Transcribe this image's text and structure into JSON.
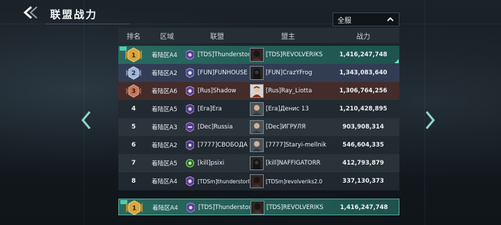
{
  "header": {
    "title": "联盟战力",
    "region_selected": "全服"
  },
  "columns": {
    "rank": "排名",
    "zone": "区域",
    "alliance": "联盟",
    "leader": "盟主",
    "power": "战力"
  },
  "rows": [
    {
      "rank": "1",
      "zone": "着陆区A4",
      "alliance": "[TDS]Thunderstorm",
      "leader": "[TDS]REVOLVERIKS",
      "power": "1,416,247,748"
    },
    {
      "rank": "2",
      "zone": "着陆区A2",
      "alliance": "[FUN]FUNHOUSE",
      "leader": "[FUN]CrazYFrog",
      "power": "1,343,083,640"
    },
    {
      "rank": "3",
      "zone": "着陆区A6",
      "alliance": "[Rus]Shadow",
      "leader": "[Rus]Ray_Liotta",
      "power": "1,306,764,256"
    },
    {
      "rank": "4",
      "zone": "着陆区A5",
      "alliance": "[Era]Era",
      "leader": "[Era]Денис 13",
      "power": "1,210,428,895"
    },
    {
      "rank": "5",
      "zone": "着陆区A3",
      "alliance": "[Dec]Russia",
      "leader": "[Dec]ИГРУЛЯ",
      "power": "903,908,314"
    },
    {
      "rank": "6",
      "zone": "着陆区A2",
      "alliance": "[7777]СВОБОДА",
      "leader": "[7777]Staryi-mellnik",
      "power": "546,604,335"
    },
    {
      "rank": "7",
      "zone": "着陆区A5",
      "alliance": "[kill]psixi",
      "leader": "[kill]NAFFIGATORR",
      "power": "412,793,879"
    },
    {
      "rank": "8",
      "zone": "着陆区A4",
      "alliance": "[TDSm]thunderstorMINI",
      "leader": "[TDSm]revolveriks2.0",
      "power": "337,130,373"
    }
  ],
  "self_row": {
    "rank": "1",
    "zone": "着陆区A4",
    "alliance": "[TDS]Thunderstorm",
    "leader": "[TDS]REVOLVERIKS",
    "power": "1,416,247,748"
  },
  "colors": {
    "gold": "#d8a640",
    "silver": "#9fb3d8",
    "bronze": "#c27a5e",
    "accent": "#6fe0c8"
  }
}
